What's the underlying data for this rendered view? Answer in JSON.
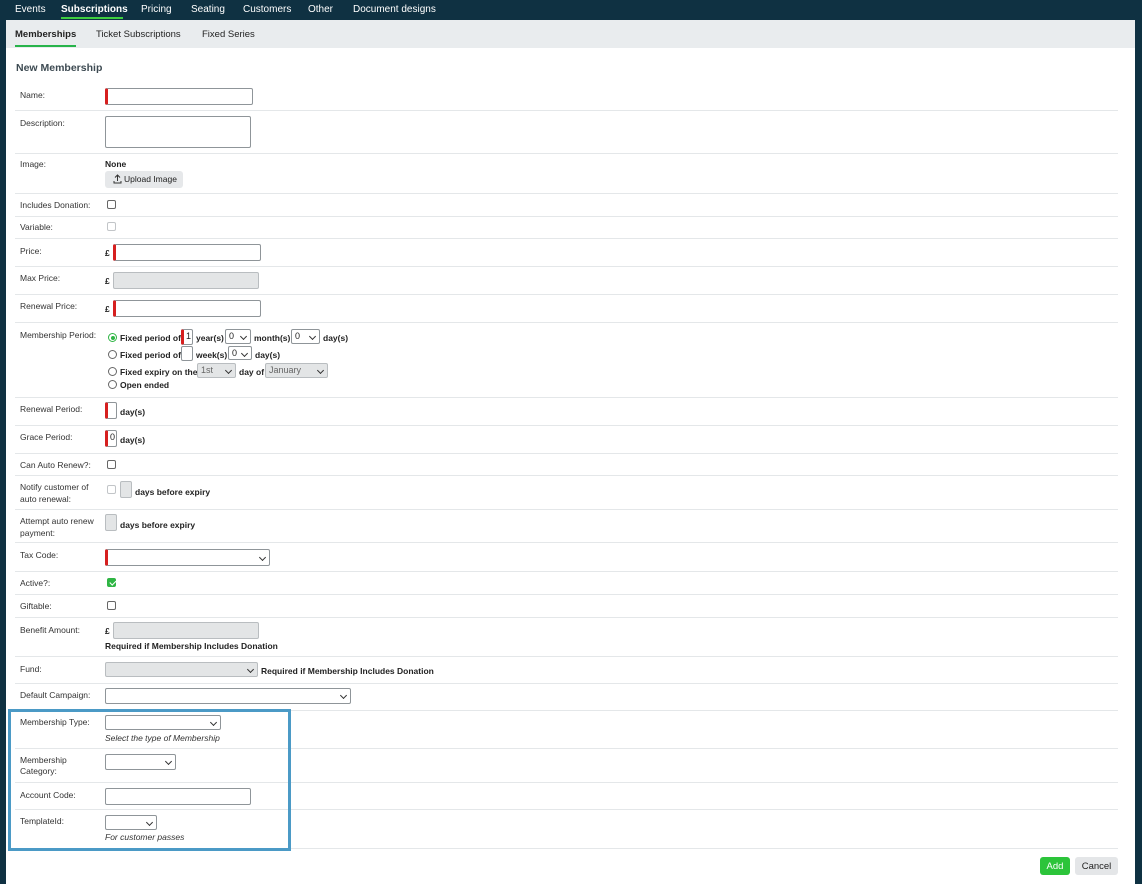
{
  "top_nav": [
    "Events",
    "Subscriptions",
    "Pricing",
    "Seating",
    "Customers",
    "Other",
    "Document designs"
  ],
  "sub_nav": [
    "Memberships",
    "Ticket Subscriptions",
    "Fixed Series"
  ],
  "page_title": "New Membership",
  "labels": {
    "name": "Name:",
    "description": "Description:",
    "image": "Image:",
    "includes_donation": "Includes Donation:",
    "variable": "Variable:",
    "price": "Price:",
    "max_price": "Max Price:",
    "renewal_price": "Renewal Price:",
    "membership_period": "Membership Period:",
    "renewal_period": "Renewal Period:",
    "grace_period": "Grace Period:",
    "can_auto_renew": "Can Auto Renew?:",
    "notify_line1": "Notify customer of",
    "notify_line2": "auto renewal:",
    "attempt_line1": "Attempt auto renew",
    "attempt_line2": "payment:",
    "tax_code": "Tax Code:",
    "active": "Active?:",
    "giftable": "Giftable:",
    "benefit_amount": "Benefit Amount:",
    "fund": "Fund:",
    "default_campaign": "Default Campaign:",
    "membership_type": "Membership Type:",
    "membership_category_line1": "Membership",
    "membership_category_line2": "Category:",
    "account_code": "Account Code:",
    "template_id": "TemplateId:"
  },
  "currency_symbol": "£",
  "image": {
    "value": "None",
    "upload_label": "Upload Image"
  },
  "membership_period": {
    "fixed_period_of": "Fixed period of",
    "years_value": "1",
    "years_unit": "year(s)",
    "months_value": "0",
    "months_unit": "month(s)",
    "days_value": "0",
    "days_unit": "day(s)",
    "weeks_unit": "week(s)",
    "weeks_days_value": "0",
    "weeks_days_unit": "day(s)",
    "fixed_expiry_on_the": "Fixed expiry on the",
    "expiry_day_value": "1st",
    "day_of": "day of",
    "expiry_month_value": "January",
    "open_ended": "Open ended"
  },
  "renewal_period_unit": "day(s)",
  "grace_period": {
    "value": "0",
    "unit": "day(s)"
  },
  "notify_suffix": "days before expiry",
  "attempt_suffix": "days before expiry",
  "benefit_note": "Required if Membership Includes Donation",
  "fund_note": "Required if Membership Includes Donation",
  "membership_type_hint": "Select the type of Membership",
  "template_hint": "For customer passes",
  "buttons": {
    "add": "Add",
    "cancel": "Cancel"
  },
  "colors": {
    "nav_bg": "#0f3142",
    "accent_green": "#2cc43a",
    "required_red": "#d61f1f",
    "highlight_blue": "#4b9ac6"
  },
  "checkbox_states": {
    "includes_donation": false,
    "variable": false,
    "can_auto_renew": false,
    "notify": false,
    "active": true,
    "giftable": false
  }
}
